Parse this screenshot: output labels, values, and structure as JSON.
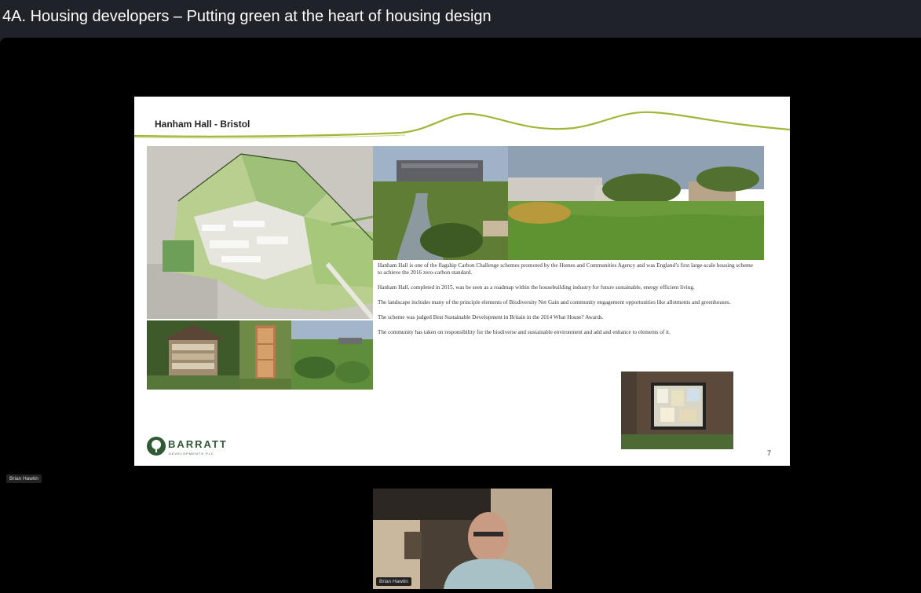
{
  "window": {
    "title": "4A. Housing developers – Putting green at the heart of housing design"
  },
  "slide": {
    "heading": "Hanham Hall - Bristol",
    "paragraphs": [
      "Hanham Hall is one of the flagship Carbon Challenge schemes promoted by the Homes and Communities Agency and was England’s first large-scale housing scheme to achieve the 2016 zero-carbon standard.",
      "Hanham Hall, completed in 2015, was be seen as a roadmap within the housebuilding industry for future sustainable, energy efficient living.",
      "The landscape includes many of the principle elements of Biodiversity Net Gain and community engagement opportunities like allotments and greenhouses.",
      "The scheme was judged Best Sustainable Development in Britain in the 2014 What House? Awards.",
      "The community has taken on responsibility for the biodiverse and sustainable environment and add and enhance to elements of it."
    ],
    "logo_name": "BARRATT",
    "logo_sub": "DEVELOPMENTS PLC",
    "page_number": "7",
    "accent_color": "#a3b53a"
  },
  "participants": {
    "main_label": "Brian Hawtin",
    "tile_label": "Brian Hawtin"
  }
}
